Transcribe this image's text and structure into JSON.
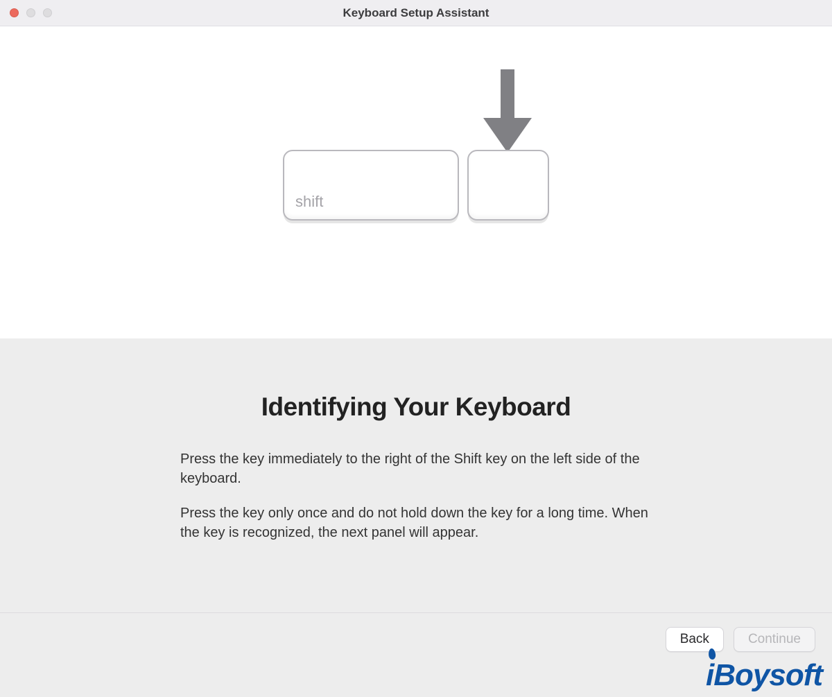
{
  "window": {
    "title": "Keyboard Setup Assistant"
  },
  "illustration": {
    "shift_label": "shift"
  },
  "main": {
    "heading": "Identifying Your Keyboard",
    "paragraph1": "Press the key immediately to the right of the Shift key on the left side of the keyboard.",
    "paragraph2": "Press the key only once and do not hold down the key for a long time. When the key is recognized, the next panel will appear."
  },
  "buttons": {
    "back": "Back",
    "continue": "Continue"
  },
  "watermark": {
    "text": "iBoysoft"
  }
}
